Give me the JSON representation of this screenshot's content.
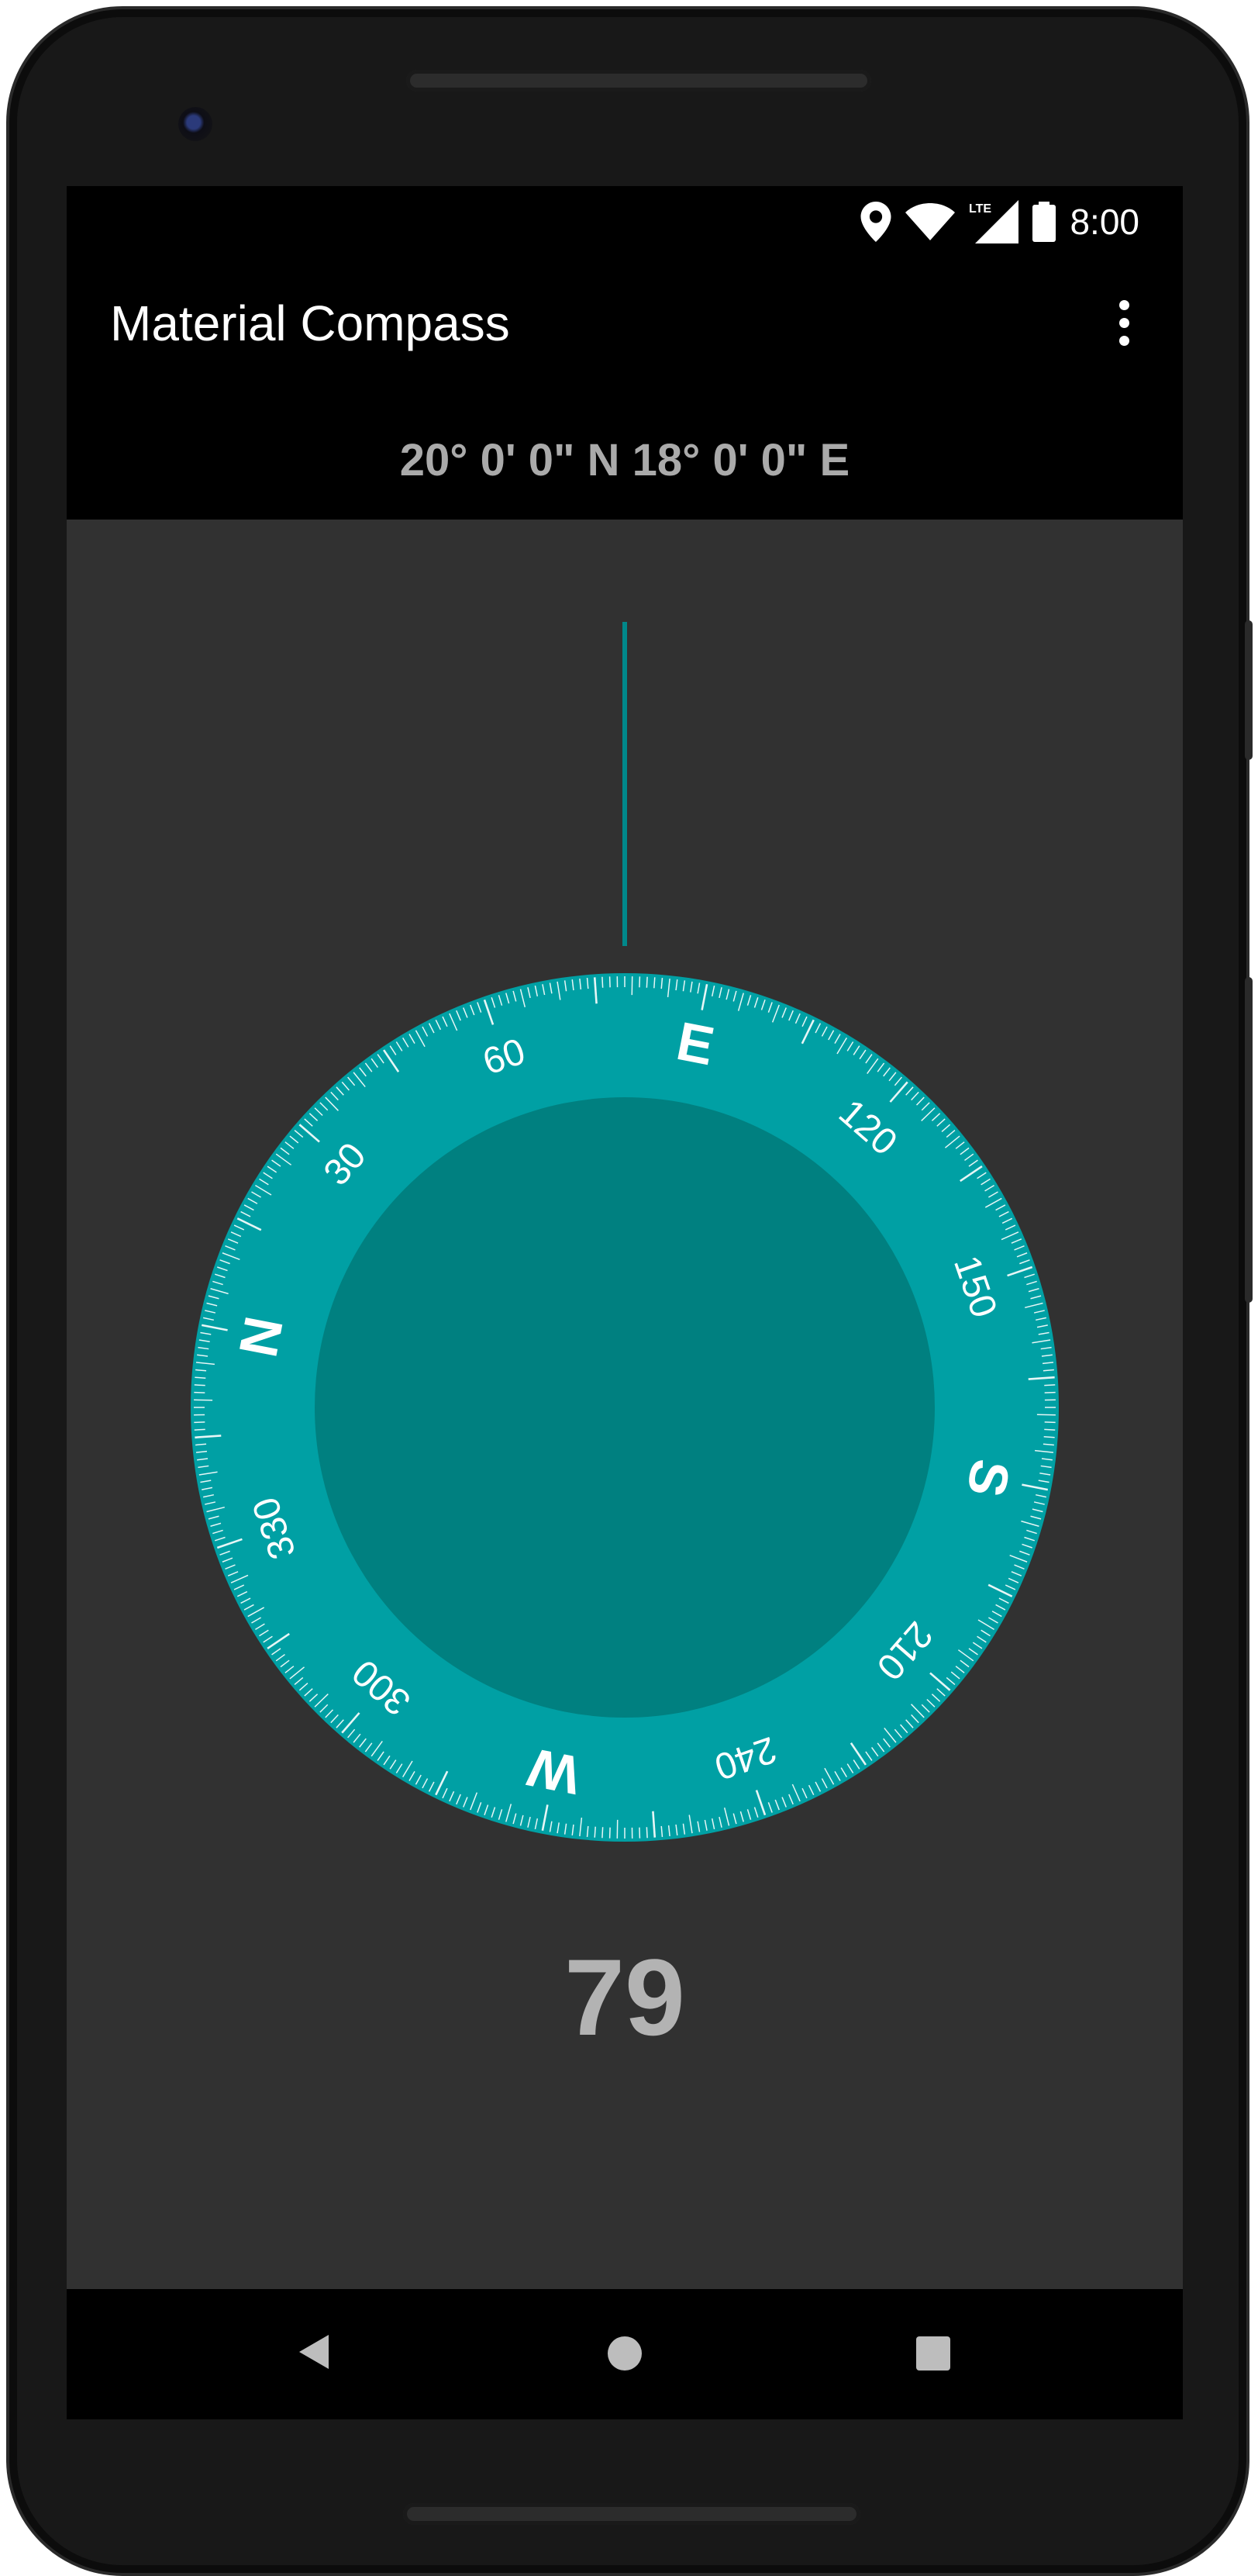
{
  "app": {
    "title": "Material Compass"
  },
  "status_bar": {
    "time": "8:00",
    "network_label": "LTE",
    "icons": [
      "location-pin-icon",
      "wifi-icon",
      "lte-signal-icon",
      "battery-icon"
    ]
  },
  "location": {
    "coordinates": "20° 0' 0\" N  18° 0' 0\" E"
  },
  "compass": {
    "heading_value": "79",
    "cardinals": {
      "north": "N",
      "east": "E",
      "south": "S",
      "west": "W"
    },
    "degree_labels": [
      "30",
      "60",
      "120",
      "150",
      "210",
      "240",
      "300",
      "330"
    ]
  },
  "nav_bar": {
    "icons": [
      "back-icon",
      "home-icon",
      "recent-apps-icon"
    ]
  },
  "colors": {
    "ring": "#00a0a4",
    "face": "#008080",
    "needle": "#00888a",
    "background": "#313131",
    "bars": "#000000",
    "heading_text": "#b3b3b3",
    "coords_text": "#aaaaaa"
  }
}
